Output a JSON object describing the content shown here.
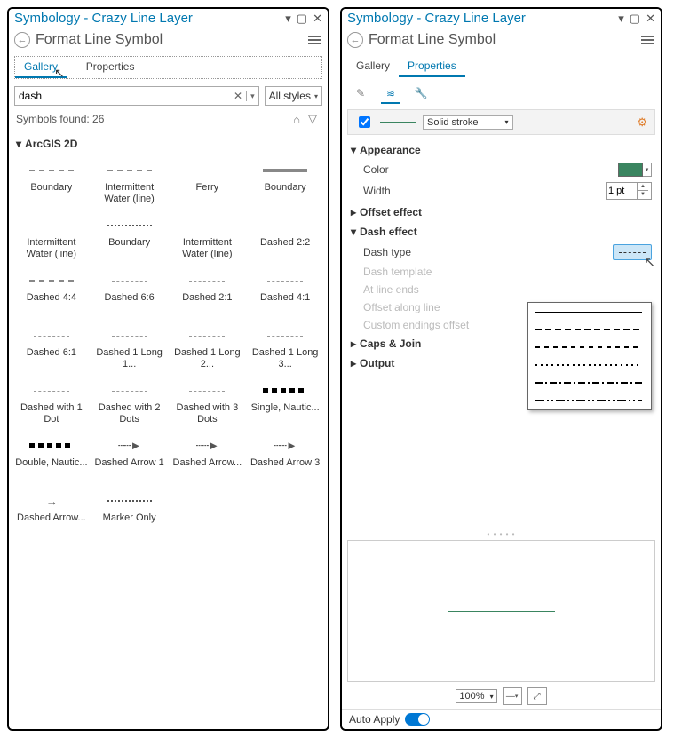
{
  "left": {
    "title": "Symbology - Crazy Line Layer",
    "subtitle": "Format Line Symbol",
    "tabs": {
      "gallery": "Gallery",
      "properties": "Properties",
      "active": "Gallery"
    },
    "search": {
      "value": "dash",
      "styles": "All styles"
    },
    "found": "Symbols found: 26",
    "category": "ArcGIS 2D",
    "items": [
      "Boundary",
      "Intermittent Water (line)",
      "Ferry",
      "Boundary",
      "Intermittent Water (line)",
      "Boundary",
      "Intermittent Water (line)",
      "Dashed 2:2",
      "Dashed 4:4",
      "Dashed 6:6",
      "Dashed 2:1",
      "Dashed 4:1",
      "Dashed 6:1",
      "Dashed 1 Long 1...",
      "Dashed 1 Long 2...",
      "Dashed 1 Long 3...",
      "Dashed with 1 Dot",
      "Dashed with 2 Dots",
      "Dashed with 3 Dots",
      "Single, Nautic...",
      "Double, Nautic...",
      "Dashed Arrow 1",
      "Dashed Arrow...",
      "Dashed Arrow 3",
      "Dashed Arrow...",
      "Marker Only"
    ]
  },
  "right": {
    "title": "Symbology - Crazy Line Layer",
    "subtitle": "Format Line Symbol",
    "tabs": {
      "gallery": "Gallery",
      "properties": "Properties",
      "active": "Properties"
    },
    "stroke_dd": "Solid stroke",
    "sections": {
      "appearance": "Appearance",
      "color": "Color",
      "width": "Width",
      "width_val": "1 pt",
      "offset": "Offset effect",
      "dash": "Dash effect",
      "dash_type": "Dash type",
      "dash_template": "Dash template",
      "line_ends": "At line ends",
      "offset_along": "Offset along line",
      "custom_end": "Custom endings offset",
      "caps": "Caps & Join",
      "output": "Output"
    },
    "zoom": "100%",
    "auto_apply": "Auto Apply",
    "color_value": "#3a8560"
  }
}
